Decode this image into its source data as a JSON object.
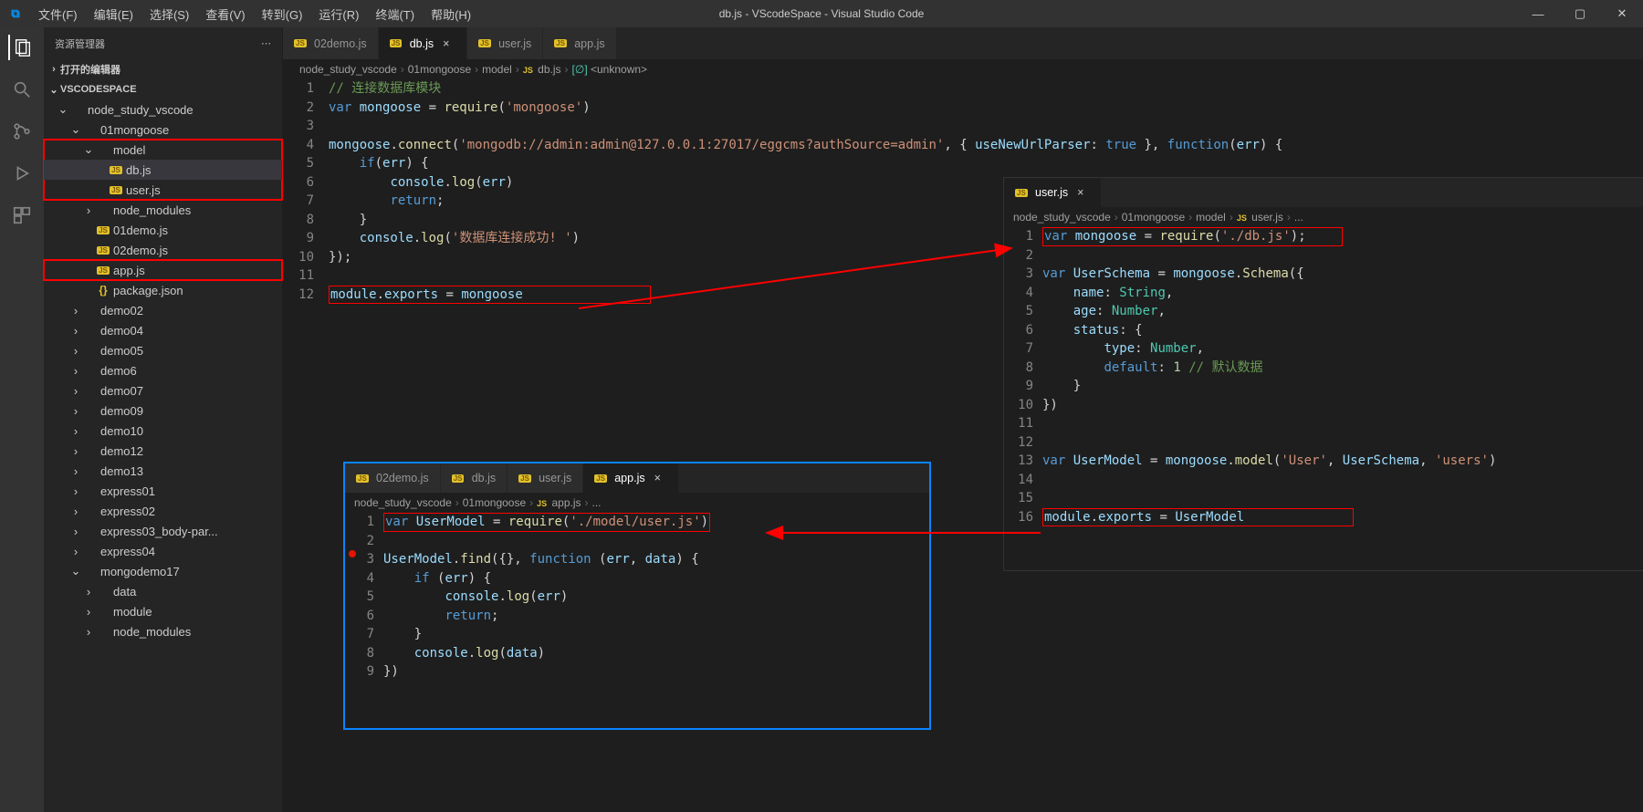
{
  "titlebar": {
    "title": "db.js - VScodeSpace - Visual Studio Code",
    "menus": [
      "文件(F)",
      "编辑(E)",
      "选择(S)",
      "查看(V)",
      "转到(G)",
      "运行(R)",
      "终端(T)",
      "帮助(H)"
    ]
  },
  "sidebar": {
    "title": "资源管理器",
    "open_editors": "打开的编辑器",
    "workspace": "VSCODESPACE",
    "tree": [
      {
        "depth": 1,
        "twisty": "v",
        "label": "node_study_vscode",
        "type": "folder"
      },
      {
        "depth": 2,
        "twisty": "v",
        "label": "01mongoose",
        "type": "folder"
      },
      {
        "depth": 3,
        "twisty": "v",
        "label": "model",
        "type": "folder",
        "boxStart": true
      },
      {
        "depth": 4,
        "label": "db.js",
        "type": "js",
        "selected": true
      },
      {
        "depth": 4,
        "label": "user.js",
        "type": "js",
        "boxEnd": true
      },
      {
        "depth": 3,
        "twisty": ">",
        "label": "node_modules",
        "type": "folder"
      },
      {
        "depth": 3,
        "label": "01demo.js",
        "type": "js"
      },
      {
        "depth": 3,
        "label": "02demo.js",
        "type": "js"
      },
      {
        "depth": 3,
        "label": "app.js",
        "type": "js",
        "box": true
      },
      {
        "depth": 3,
        "label": "package.json",
        "type": "json"
      },
      {
        "depth": 2,
        "twisty": ">",
        "label": "demo02",
        "type": "folder"
      },
      {
        "depth": 2,
        "twisty": ">",
        "label": "demo04",
        "type": "folder"
      },
      {
        "depth": 2,
        "twisty": ">",
        "label": "demo05",
        "type": "folder"
      },
      {
        "depth": 2,
        "twisty": ">",
        "label": "demo6",
        "type": "folder"
      },
      {
        "depth": 2,
        "twisty": ">",
        "label": "demo07",
        "type": "folder"
      },
      {
        "depth": 2,
        "twisty": ">",
        "label": "demo09",
        "type": "folder"
      },
      {
        "depth": 2,
        "twisty": ">",
        "label": "demo10",
        "type": "folder"
      },
      {
        "depth": 2,
        "twisty": ">",
        "label": "demo12",
        "type": "folder"
      },
      {
        "depth": 2,
        "twisty": ">",
        "label": "demo13",
        "type": "folder"
      },
      {
        "depth": 2,
        "twisty": ">",
        "label": "express01",
        "type": "folder"
      },
      {
        "depth": 2,
        "twisty": ">",
        "label": "express02",
        "type": "folder"
      },
      {
        "depth": 2,
        "twisty": ">",
        "label": "express03_body-par...",
        "type": "folder"
      },
      {
        "depth": 2,
        "twisty": ">",
        "label": "express04",
        "type": "folder"
      },
      {
        "depth": 2,
        "twisty": "v",
        "label": "mongodemo17",
        "type": "folder"
      },
      {
        "depth": 3,
        "twisty": ">",
        "label": "data",
        "type": "folder"
      },
      {
        "depth": 3,
        "twisty": ">",
        "label": "module",
        "type": "folder"
      },
      {
        "depth": 3,
        "twisty": ">",
        "label": "node_modules",
        "type": "folder"
      }
    ]
  },
  "main_tabs": [
    {
      "label": "02demo.js",
      "active": false
    },
    {
      "label": "db.js",
      "active": true,
      "close": true
    },
    {
      "label": "user.js",
      "active": false
    },
    {
      "label": "app.js",
      "active": false
    }
  ],
  "main_breadcrumb": [
    "node_study_vscode",
    "01mongoose",
    "model",
    "db.js",
    "<unknown>"
  ],
  "main_code": {
    "nums": [
      1,
      2,
      3,
      4,
      5,
      6,
      7,
      8,
      9,
      10,
      11,
      12
    ],
    "lines": [
      [
        {
          "t": "// 连接数据库模块",
          "c": "cmt"
        }
      ],
      [
        {
          "t": "var ",
          "c": "kw"
        },
        {
          "t": "mongoose",
          "c": "var"
        },
        {
          "t": " = ",
          "c": "punc"
        },
        {
          "t": "require",
          "c": "fn"
        },
        {
          "t": "(",
          "c": "punc"
        },
        {
          "t": "'mongoose'",
          "c": "str"
        },
        {
          "t": ")",
          "c": "punc"
        }
      ],
      [],
      [
        {
          "t": "mongoose",
          "c": "var"
        },
        {
          "t": ".",
          "c": "punc"
        },
        {
          "t": "connect",
          "c": "fn"
        },
        {
          "t": "(",
          "c": "punc"
        },
        {
          "t": "'mongodb://admin:admin@127.0.0.1:27017/eggcms?authSource=admin'",
          "c": "str"
        },
        {
          "t": ", { ",
          "c": "punc"
        },
        {
          "t": "useNewUrlParser",
          "c": "prop"
        },
        {
          "t": ": ",
          "c": "punc"
        },
        {
          "t": "true",
          "c": "kw"
        },
        {
          "t": " }, ",
          "c": "punc"
        },
        {
          "t": "function",
          "c": "kw"
        },
        {
          "t": "(",
          "c": "punc"
        },
        {
          "t": "err",
          "c": "var"
        },
        {
          "t": ") {",
          "c": "punc"
        }
      ],
      [
        {
          "t": "    ",
          "c": "punc"
        },
        {
          "t": "if",
          "c": "kw"
        },
        {
          "t": "(",
          "c": "punc"
        },
        {
          "t": "err",
          "c": "var"
        },
        {
          "t": ") {",
          "c": "punc"
        }
      ],
      [
        {
          "t": "        ",
          "c": "punc"
        },
        {
          "t": "console",
          "c": "var"
        },
        {
          "t": ".",
          "c": "punc"
        },
        {
          "t": "log",
          "c": "fn"
        },
        {
          "t": "(",
          "c": "punc"
        },
        {
          "t": "err",
          "c": "var"
        },
        {
          "t": ")",
          "c": "punc"
        }
      ],
      [
        {
          "t": "        ",
          "c": "punc"
        },
        {
          "t": "return",
          "c": "kw"
        },
        {
          "t": ";",
          "c": "punc"
        }
      ],
      [
        {
          "t": "    }",
          "c": "punc"
        }
      ],
      [
        {
          "t": "    ",
          "c": "punc"
        },
        {
          "t": "console",
          "c": "var"
        },
        {
          "t": ".",
          "c": "punc"
        },
        {
          "t": "log",
          "c": "fn"
        },
        {
          "t": "(",
          "c": "punc"
        },
        {
          "t": "'数据库连接成功! '",
          "c": "str"
        },
        {
          "t": ")",
          "c": "punc"
        }
      ],
      [
        {
          "t": "});",
          "c": "punc"
        }
      ],
      [],
      [
        {
          "t": "module",
          "c": "var"
        },
        {
          "t": ".",
          "c": "punc"
        },
        {
          "t": "exports",
          "c": "var"
        },
        {
          "t": " = ",
          "c": "punc"
        },
        {
          "t": "mongoose",
          "c": "var"
        }
      ]
    ],
    "box_line": 12
  },
  "app_panel": {
    "tabs": [
      {
        "label": "02demo.js"
      },
      {
        "label": "db.js"
      },
      {
        "label": "user.js"
      },
      {
        "label": "app.js",
        "active": true,
        "close": true
      }
    ],
    "breadcrumb": [
      "node_study_vscode",
      "01mongoose",
      "app.js",
      "..."
    ],
    "nums": [
      1,
      2,
      3,
      4,
      5,
      6,
      7,
      8,
      9
    ],
    "lines": [
      [
        {
          "t": "var ",
          "c": "kw"
        },
        {
          "t": "UserModel",
          "c": "var"
        },
        {
          "t": " = ",
          "c": "punc"
        },
        {
          "t": "require",
          "c": "fn"
        },
        {
          "t": "(",
          "c": "punc"
        },
        {
          "t": "'./model/user.js'",
          "c": "str"
        },
        {
          "t": ")",
          "c": "punc"
        }
      ],
      [],
      [
        {
          "t": "UserModel",
          "c": "var"
        },
        {
          "t": ".",
          "c": "punc"
        },
        {
          "t": "find",
          "c": "fn"
        },
        {
          "t": "({}, ",
          "c": "punc"
        },
        {
          "t": "function",
          "c": "kw"
        },
        {
          "t": " (",
          "c": "punc"
        },
        {
          "t": "err",
          "c": "var"
        },
        {
          "t": ", ",
          "c": "punc"
        },
        {
          "t": "data",
          "c": "var"
        },
        {
          "t": ") {",
          "c": "punc"
        }
      ],
      [
        {
          "t": "    ",
          "c": "punc"
        },
        {
          "t": "if",
          "c": "kw"
        },
        {
          "t": " (",
          "c": "punc"
        },
        {
          "t": "err",
          "c": "var"
        },
        {
          "t": ") {",
          "c": "punc"
        }
      ],
      [
        {
          "t": "        ",
          "c": "punc"
        },
        {
          "t": "console",
          "c": "var"
        },
        {
          "t": ".",
          "c": "punc"
        },
        {
          "t": "log",
          "c": "fn"
        },
        {
          "t": "(",
          "c": "punc"
        },
        {
          "t": "err",
          "c": "var"
        },
        {
          "t": ")",
          "c": "punc"
        }
      ],
      [
        {
          "t": "        ",
          "c": "punc"
        },
        {
          "t": "return",
          "c": "kw"
        },
        {
          "t": ";",
          "c": "punc"
        }
      ],
      [
        {
          "t": "    }",
          "c": "punc"
        }
      ],
      [
        {
          "t": "    ",
          "c": "punc"
        },
        {
          "t": "console",
          "c": "var"
        },
        {
          "t": ".",
          "c": "punc"
        },
        {
          "t": "log",
          "c": "fn"
        },
        {
          "t": "(",
          "c": "punc"
        },
        {
          "t": "data",
          "c": "var"
        },
        {
          "t": ")",
          "c": "punc"
        }
      ],
      [
        {
          "t": "})",
          "c": "punc"
        }
      ]
    ],
    "box_line": 1
  },
  "user_panel": {
    "tabs": [
      {
        "label": "user.js",
        "active": true,
        "close": true
      }
    ],
    "breadcrumb": [
      "node_study_vscode",
      "01mongoose",
      "model",
      "user.js",
      "..."
    ],
    "nums": [
      1,
      2,
      3,
      4,
      5,
      6,
      7,
      8,
      9,
      10,
      11,
      12,
      13,
      14,
      15,
      16
    ],
    "lines": [
      [
        {
          "t": "var ",
          "c": "kw"
        },
        {
          "t": "mongoose",
          "c": "var"
        },
        {
          "t": " = ",
          "c": "punc"
        },
        {
          "t": "require",
          "c": "fn"
        },
        {
          "t": "(",
          "c": "punc"
        },
        {
          "t": "'./db.js'",
          "c": "str"
        },
        {
          "t": ");",
          "c": "punc"
        }
      ],
      [],
      [
        {
          "t": "var ",
          "c": "kw"
        },
        {
          "t": "UserSchema",
          "c": "var"
        },
        {
          "t": " = ",
          "c": "punc"
        },
        {
          "t": "mongoose",
          "c": "var"
        },
        {
          "t": ".",
          "c": "punc"
        },
        {
          "t": "Schema",
          "c": "fn"
        },
        {
          "t": "({",
          "c": "punc"
        }
      ],
      [
        {
          "t": "    ",
          "c": "punc"
        },
        {
          "t": "name",
          "c": "prop"
        },
        {
          "t": ": ",
          "c": "punc"
        },
        {
          "t": "String",
          "c": "type"
        },
        {
          "t": ",",
          "c": "punc"
        }
      ],
      [
        {
          "t": "    ",
          "c": "punc"
        },
        {
          "t": "age",
          "c": "prop"
        },
        {
          "t": ": ",
          "c": "punc"
        },
        {
          "t": "Number",
          "c": "type"
        },
        {
          "t": ",",
          "c": "punc"
        }
      ],
      [
        {
          "t": "    ",
          "c": "punc"
        },
        {
          "t": "status",
          "c": "prop"
        },
        {
          "t": ": {",
          "c": "punc"
        }
      ],
      [
        {
          "t": "        ",
          "c": "punc"
        },
        {
          "t": "type",
          "c": "prop"
        },
        {
          "t": ": ",
          "c": "punc"
        },
        {
          "t": "Number",
          "c": "type"
        },
        {
          "t": ",",
          "c": "punc"
        }
      ],
      [
        {
          "t": "        ",
          "c": "punc"
        },
        {
          "t": "default",
          "c": "kw"
        },
        {
          "t": ": ",
          "c": "punc"
        },
        {
          "t": "1",
          "c": "num"
        },
        {
          "t": " ",
          "c": "punc"
        },
        {
          "t": "// 默认数据",
          "c": "cmt"
        }
      ],
      [
        {
          "t": "    }",
          "c": "punc"
        }
      ],
      [
        {
          "t": "})",
          "c": "punc"
        }
      ],
      [],
      [],
      [
        {
          "t": "var ",
          "c": "kw"
        },
        {
          "t": "UserModel",
          "c": "var"
        },
        {
          "t": " = ",
          "c": "punc"
        },
        {
          "t": "mongoose",
          "c": "var"
        },
        {
          "t": ".",
          "c": "punc"
        },
        {
          "t": "model",
          "c": "fn"
        },
        {
          "t": "(",
          "c": "punc"
        },
        {
          "t": "'User'",
          "c": "str"
        },
        {
          "t": ", ",
          "c": "punc"
        },
        {
          "t": "UserSchema",
          "c": "var"
        },
        {
          "t": ", ",
          "c": "punc"
        },
        {
          "t": "'users'",
          "c": "str"
        },
        {
          "t": ")",
          "c": "punc"
        }
      ],
      [],
      [],
      [
        {
          "t": "module",
          "c": "var"
        },
        {
          "t": ".",
          "c": "punc"
        },
        {
          "t": "exports",
          "c": "var"
        },
        {
          "t": " = ",
          "c": "punc"
        },
        {
          "t": "UserModel",
          "c": "var"
        }
      ]
    ],
    "box_lines": [
      1,
      16
    ]
  }
}
